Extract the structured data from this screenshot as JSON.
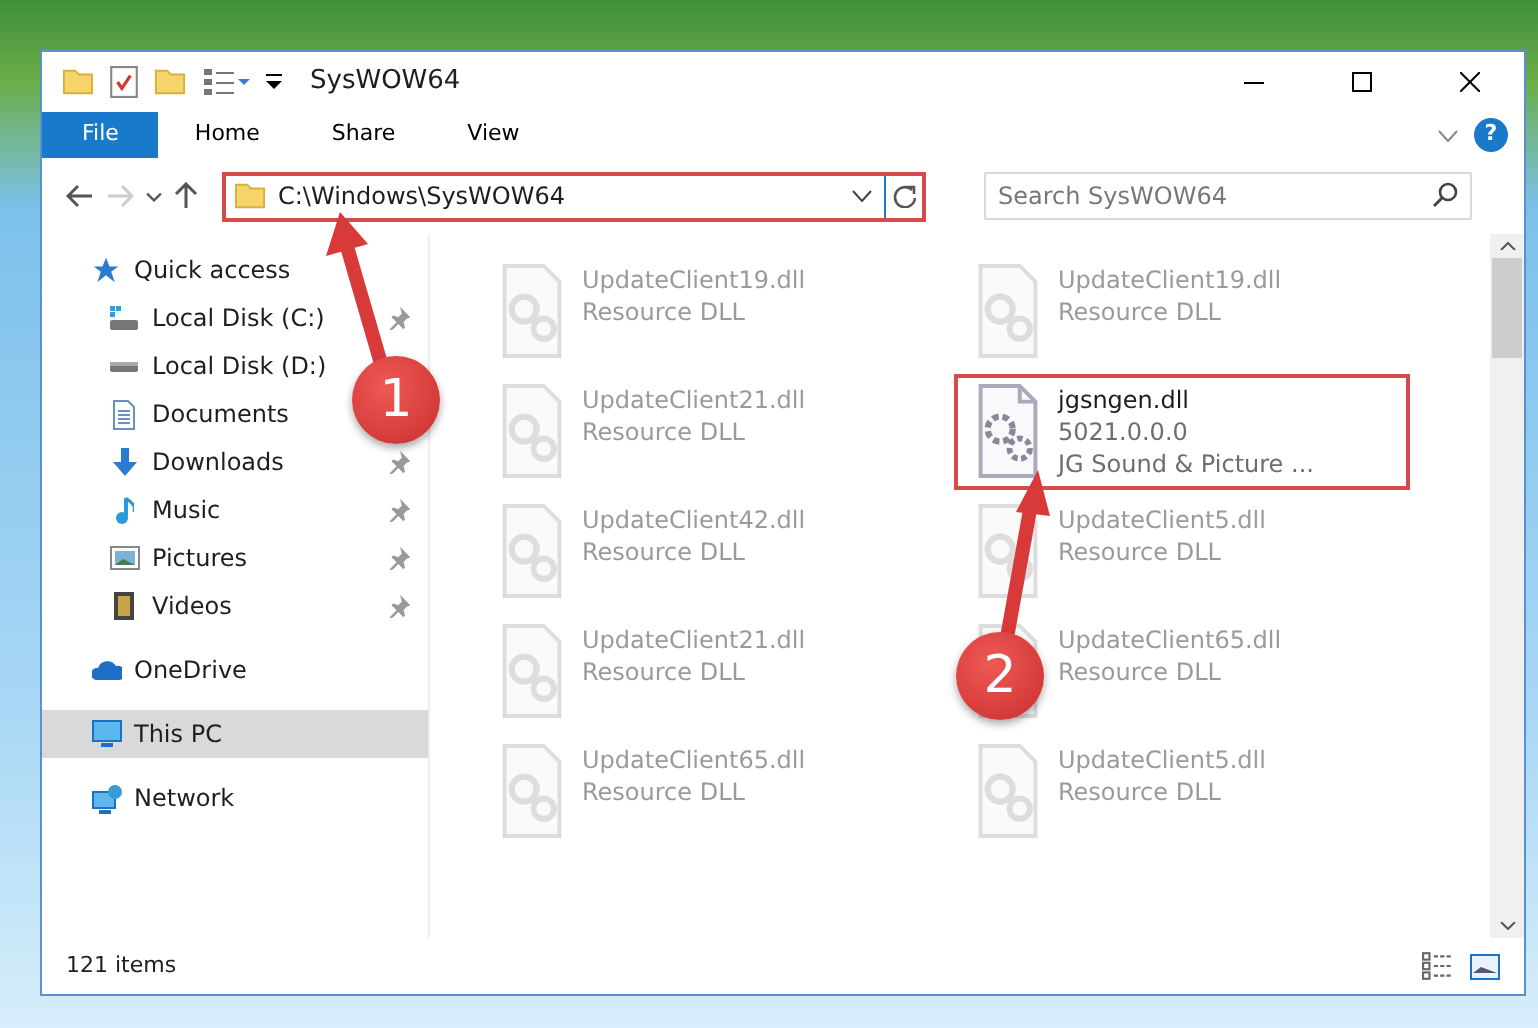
{
  "window": {
    "title": "SysWOW64"
  },
  "ribbon_tabs": [
    {
      "label": "File",
      "kind": "file"
    },
    {
      "label": "Home",
      "kind": "tab"
    },
    {
      "label": "Share",
      "kind": "tab"
    },
    {
      "label": "View",
      "kind": "tab"
    }
  ],
  "help_button": "?",
  "address_bar": {
    "path": "C:\\Windows\\SysWOW64",
    "highlighted": true
  },
  "search": {
    "placeholder": "Search SysWOW64"
  },
  "sidebar": {
    "items": [
      {
        "label": "Quick access",
        "selected": false,
        "children": [
          {
            "label": "Local Disk (C:)",
            "pinned": true
          },
          {
            "label": "Local Disk (D:)"
          },
          {
            "label": "Documents"
          },
          {
            "label": "Downloads",
            "pinned": true
          },
          {
            "label": "Music",
            "pinned": true
          },
          {
            "label": "Pictures",
            "pinned": true
          },
          {
            "label": "Videos",
            "pinned": true
          }
        ]
      },
      {
        "label": "OneDrive",
        "selected": false
      },
      {
        "label": "This PC",
        "selected": true
      },
      {
        "label": "Network",
        "selected": false
      }
    ]
  },
  "files": [
    {
      "name": "UpdateClient19.dll",
      "details": [
        "Resource DLL"
      ],
      "highlighted": false,
      "blurred": true
    },
    {
      "name": "UpdateClient19.dll",
      "details": [
        "Resource DLL"
      ],
      "highlighted": false,
      "blurred": true
    },
    {
      "name": "UpdateClient21.dll",
      "details": [
        "Resource DLL"
      ],
      "highlighted": false,
      "blurred": true
    },
    {
      "name": "jgsngen.dll",
      "details": [
        "5021.0.0.0",
        "JG Sound & Picture ..."
      ],
      "highlighted": true,
      "blurred": false
    },
    {
      "name": "UpdateClient42.dll",
      "details": [
        "Resource DLL"
      ],
      "highlighted": false,
      "blurred": true
    },
    {
      "name": "UpdateClient5.dll",
      "details": [
        "Resource DLL"
      ],
      "highlighted": false,
      "blurred": true
    },
    {
      "name": "UpdateClient21.dll",
      "details": [
        "Resource DLL"
      ],
      "highlighted": false,
      "blurred": true
    },
    {
      "name": "UpdateClient65.dll",
      "details": [
        "Resource DLL"
      ],
      "highlighted": false,
      "blurred": true
    },
    {
      "name": "UpdateClient65.dll",
      "details": [
        "Resource DLL"
      ],
      "highlighted": false,
      "blurred": true
    },
    {
      "name": "UpdateClient5.dll",
      "details": [
        "Resource DLL"
      ],
      "highlighted": false,
      "blurred": true
    }
  ],
  "status_bar": {
    "item_count": "121 items"
  },
  "annotations": [
    {
      "number": "1"
    },
    {
      "number": "2"
    }
  ]
}
